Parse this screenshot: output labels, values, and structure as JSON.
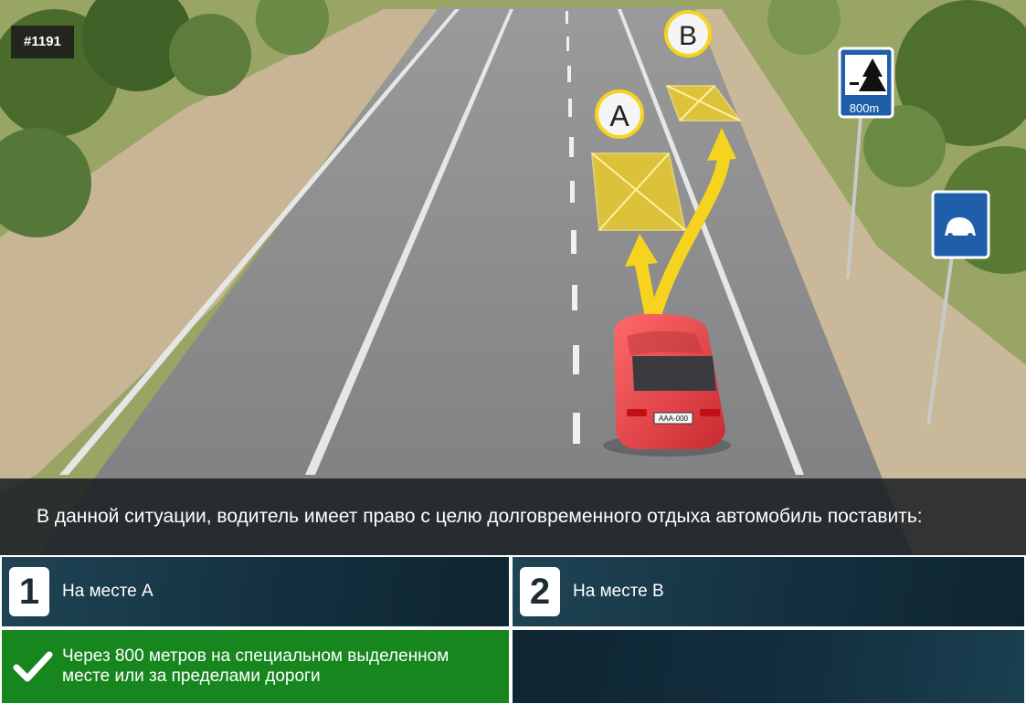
{
  "question_id": "#1191",
  "scene": {
    "marker_a": "A",
    "marker_b": "B",
    "rest_sign_distance": "800m",
    "license_plate": "AAA-000"
  },
  "question": "В данной ситуации, водитель имеет право с целю долговременного отдыха автомобиль поставить:",
  "answers": [
    {
      "number": "1",
      "text": "На месте A",
      "state": "default"
    },
    {
      "number": "2",
      "text": "На месте B",
      "state": "default"
    },
    {
      "number": "",
      "text": "Через 800 метров на специальном выделенном месте или за пределами дороги",
      "state": "correct",
      "icon": "check-icon"
    }
  ],
  "colors": {
    "correct": "#17861f",
    "answer_bg": "#14303f",
    "marker": "#f5d31e",
    "sign_blue": "#1f5ea8",
    "car_red": "#e23b3f"
  }
}
